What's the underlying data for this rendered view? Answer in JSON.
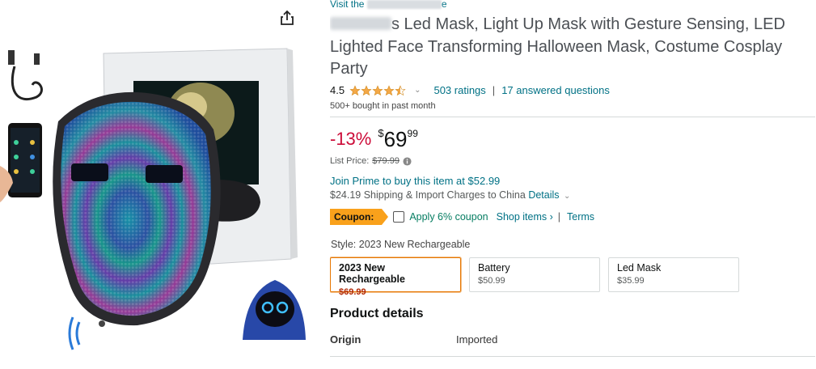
{
  "store": {
    "prefix": "Visit the",
    "suffix": "e"
  },
  "title": {
    "line1_suffix": "s Led Mask, Light Up Mask with Gesture Sensing, LED",
    "line2": "Lighted Face Transforming Halloween Mask, Costume Cosplay",
    "line3": "Party"
  },
  "rating": {
    "value": "4.5",
    "stars": 4.5,
    "count_text": "503 ratings",
    "separator": "|",
    "questions_text": "17 answered questions",
    "star_icon": "star-icon"
  },
  "bought_text": "500+ bought in past month",
  "price": {
    "discount": "-13%",
    "currency": "$",
    "whole": "69",
    "fraction": "99",
    "list_label": "List Price:",
    "list_value": "$79.99"
  },
  "prime_text": "Join Prime to buy this item at $52.99",
  "shipping": {
    "text": "$24.19 Shipping & Import Charges to China",
    "details_link": "Details"
  },
  "coupon": {
    "badge": "Coupon:",
    "apply_text": "Apply 6% coupon",
    "shop_items": "Shop items ›",
    "separator": "|",
    "terms": "Terms"
  },
  "style": {
    "label": "Style:",
    "selected": "2023 New Rechargeable",
    "options": [
      {
        "name": "2023 New Rechargeable",
        "price": "$69.99"
      },
      {
        "name": "Battery",
        "price": "$50.99"
      },
      {
        "name": "Led Mask",
        "price": "$35.99"
      }
    ]
  },
  "product_details": {
    "title": "Product details",
    "rows": [
      {
        "key": "Origin",
        "value": "Imported"
      }
    ]
  },
  "colors": {
    "link": "#007185",
    "discount": "#cc0c39",
    "star": "#f3a847",
    "coupon": "#f9a11b",
    "selected_border": "#e77600",
    "sale_price": "#b12704"
  }
}
